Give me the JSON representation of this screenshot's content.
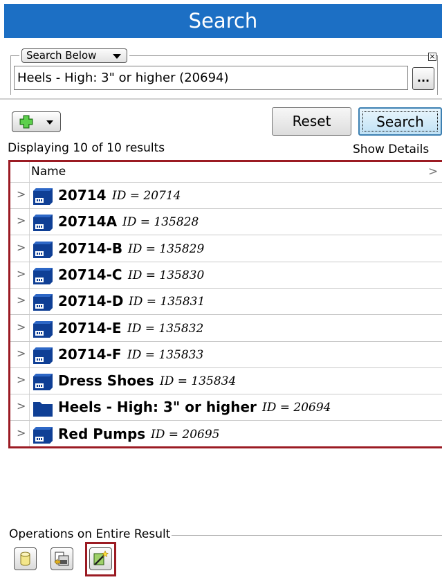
{
  "header": {
    "title": "Search"
  },
  "criteria": {
    "scope_label": "Search Below",
    "close_glyph": "×",
    "value": "Heels - High: 3\" or higher (20694)",
    "browse_label": "..."
  },
  "toolbar": {
    "add_icon": "green-plus-icon",
    "reset_label": "Reset",
    "search_label": "Search"
  },
  "results": {
    "count_text": "Displaying 10 of 10 results",
    "details_link": "Show Details",
    "column_name": "Name",
    "column_chevron": ">",
    "items": [
      {
        "name": "20714",
        "id_text": "ID = 20714",
        "icon": "part-icon"
      },
      {
        "name": "20714A",
        "id_text": "ID = 135828",
        "icon": "part-icon"
      },
      {
        "name": "20714-B",
        "id_text": "ID = 135829",
        "icon": "part-icon"
      },
      {
        "name": "20714-C",
        "id_text": "ID = 135830",
        "icon": "part-icon"
      },
      {
        "name": "20714-D",
        "id_text": "ID = 135831",
        "icon": "part-icon"
      },
      {
        "name": "20714-E",
        "id_text": "ID = 135832",
        "icon": "part-icon"
      },
      {
        "name": "20714-F",
        "id_text": "ID = 135833",
        "icon": "part-icon"
      },
      {
        "name": "Dress Shoes",
        "id_text": "ID = 135834",
        "icon": "part-icon"
      },
      {
        "name": "Heels - High: 3\" or higher",
        "id_text": "ID = 20694",
        "icon": "folder-icon"
      },
      {
        "name": "Red Pumps",
        "id_text": "ID = 20695",
        "icon": "part-icon"
      }
    ]
  },
  "operations": {
    "label": "Operations on Entire Result",
    "buttons": [
      "database-icon",
      "export-icon",
      "magic-wand-icon"
    ]
  },
  "colors": {
    "header_bg": "#1c6fc4",
    "highlight": "#9b1b23",
    "icon_blue": "#0f3f95"
  }
}
